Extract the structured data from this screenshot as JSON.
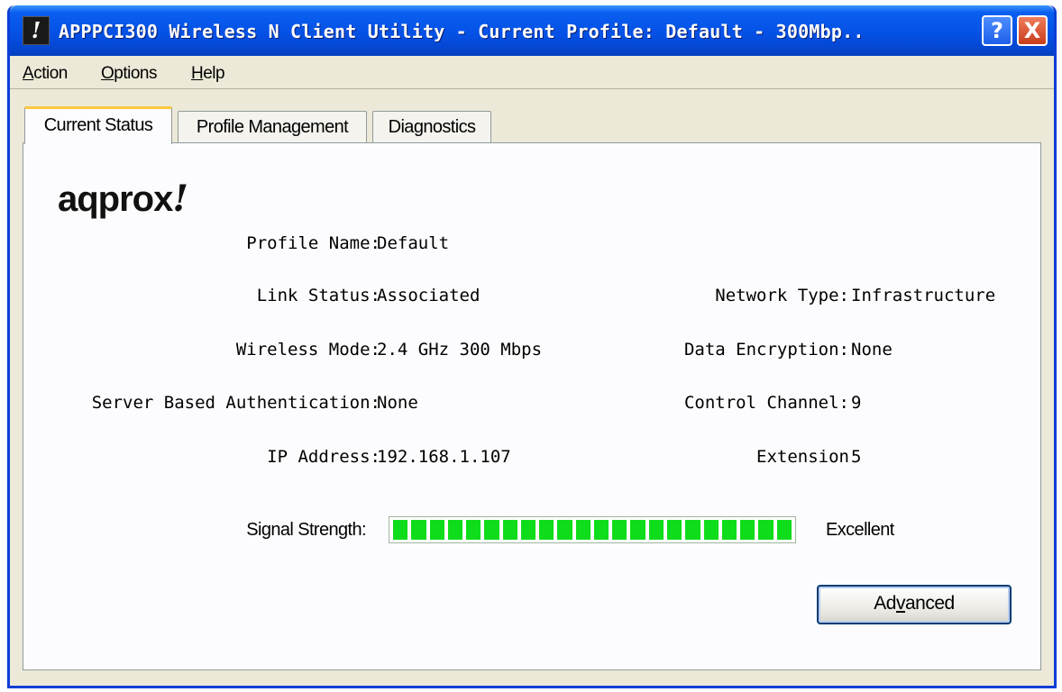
{
  "window": {
    "icon_glyph": "!",
    "title": "APPPCI300 Wireless N Client Utility - Current Profile: Default - 300Mbp..",
    "help_glyph": "?",
    "close_glyph": "X"
  },
  "menu": {
    "items": [
      {
        "accel": "A",
        "rest": "ction"
      },
      {
        "accel": "O",
        "rest": "ptions"
      },
      {
        "accel": "H",
        "rest": "elp"
      }
    ]
  },
  "tabs": [
    {
      "label": "Current Status",
      "active": true
    },
    {
      "label": "Profile Management",
      "active": false
    },
    {
      "label": "Diagnostics",
      "active": false
    }
  ],
  "logo": {
    "text": "aqprox",
    "mark": "!"
  },
  "status": {
    "profile_name_label": "Profile Name:",
    "profile_name_value": "Default",
    "link_status_label": "Link Status:",
    "link_status_value": "Associated",
    "wireless_mode_label": "Wireless Mode:",
    "wireless_mode_value": "2.4 GHz 300 Mbps",
    "server_auth_label": "Server Based Authentication:",
    "server_auth_value": "None",
    "ip_address_label": "IP Address:",
    "ip_address_value": "192.168.1.107",
    "network_type_label": "Network Type:",
    "network_type_value": "Infrastructure",
    "data_encryption_label": "Data Encryption:",
    "data_encryption_value": "None",
    "control_channel_label": "Control Channel:",
    "control_channel_value": "9",
    "extension_label": "Extension",
    "extension_value": "5"
  },
  "signal": {
    "label": "Signal Strength:",
    "quality": "Excellent",
    "level_fraction": 1.0,
    "bar_color": "#0fdc1a"
  },
  "buttons": {
    "advanced_pre": "Ad",
    "advanced_accel": "v",
    "advanced_post": "anced"
  },
  "colors": {
    "titlebar": "#0551e6",
    "window_bg": "#ece9d8",
    "active_tab_accent": "#ffc83c"
  },
  "icons": {
    "app": "warning-app-icon",
    "help": "help-icon",
    "close": "close-icon"
  }
}
